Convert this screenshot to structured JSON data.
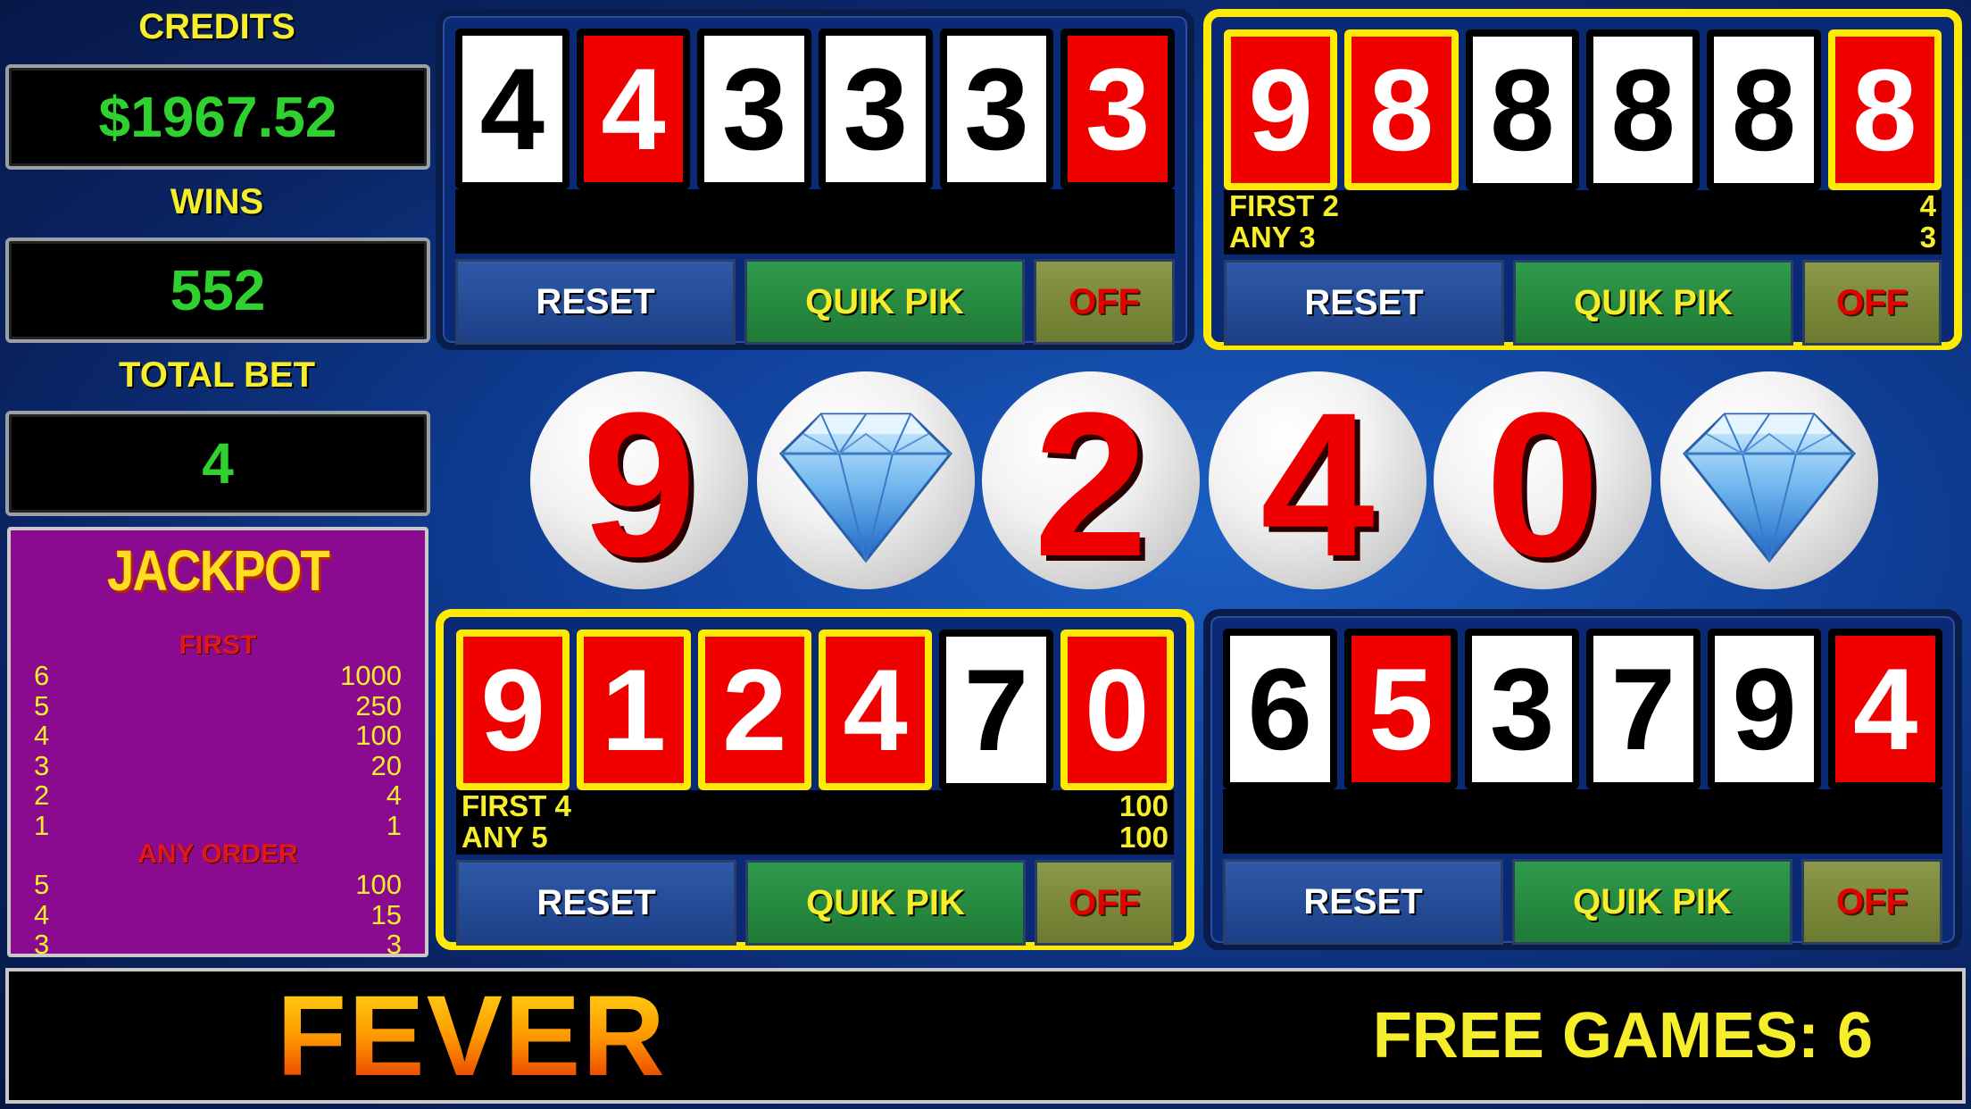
{
  "credits": {
    "label": "CREDITS",
    "value": "$1967.52"
  },
  "wins": {
    "label": "WINS",
    "value": "552"
  },
  "total_bet": {
    "label": "TOTAL BET",
    "value": "4"
  },
  "jackpot": {
    "title": "JACKPOT",
    "first_label": "FIRST",
    "first": [
      [
        "6",
        "1000"
      ],
      [
        "5",
        "250"
      ],
      [
        "4",
        "100"
      ],
      [
        "3",
        "20"
      ],
      [
        "2",
        "4"
      ],
      [
        "1",
        "1"
      ]
    ],
    "any_label": "ANY ORDER",
    "any": [
      [
        "5",
        "100"
      ],
      [
        "4",
        "15"
      ],
      [
        "3",
        "3"
      ]
    ]
  },
  "tickets": [
    {
      "digits": [
        "4",
        "4",
        "3",
        "3",
        "3",
        "3"
      ],
      "red": [
        false,
        true,
        false,
        false,
        false,
        true
      ],
      "hit": [
        false,
        false,
        false,
        false,
        false,
        false
      ],
      "highlighted": false,
      "info": []
    },
    {
      "digits": [
        "9",
        "8",
        "8",
        "8",
        "8",
        "8"
      ],
      "red": [
        true,
        true,
        false,
        false,
        false,
        true
      ],
      "hit": [
        true,
        true,
        false,
        false,
        false,
        true
      ],
      "highlighted": true,
      "info": [
        [
          "FIRST 2",
          "4"
        ],
        [
          "ANY 3",
          "3"
        ]
      ]
    },
    {
      "digits": [
        "9",
        "1",
        "2",
        "4",
        "7",
        "0"
      ],
      "red": [
        true,
        true,
        true,
        true,
        false,
        true
      ],
      "hit": [
        true,
        true,
        true,
        true,
        false,
        true
      ],
      "highlighted": true,
      "info": [
        [
          "FIRST 4",
          "100"
        ],
        [
          "ANY 5",
          "100"
        ]
      ]
    },
    {
      "digits": [
        "6",
        "5",
        "3",
        "7",
        "9",
        "4"
      ],
      "red": [
        false,
        true,
        false,
        false,
        false,
        true
      ],
      "hit": [
        false,
        false,
        false,
        false,
        false,
        false
      ],
      "highlighted": false,
      "info": []
    }
  ],
  "buttons": {
    "reset": "RESET",
    "quik": "QUIK PIK",
    "off": "OFF"
  },
  "draw": [
    {
      "type": "number",
      "value": "9"
    },
    {
      "type": "diamond"
    },
    {
      "type": "number",
      "value": "2"
    },
    {
      "type": "number",
      "value": "4"
    },
    {
      "type": "number",
      "value": "0"
    },
    {
      "type": "diamond"
    }
  ],
  "bottom": {
    "title": "FEVER",
    "free_games": "FREE GAMES: 6"
  },
  "colors": {
    "digit_red": "#f10000",
    "highlight": "#ffeb00",
    "label_yellow": "#f6ee2a",
    "value_green": "#2fd12f"
  }
}
